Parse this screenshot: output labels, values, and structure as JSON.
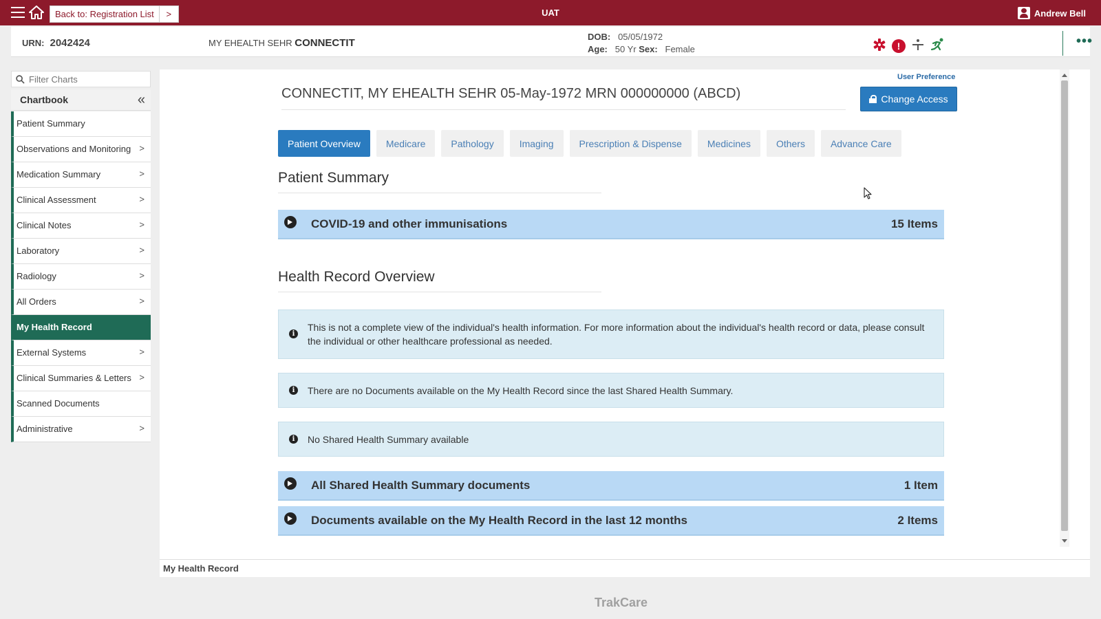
{
  "topbar": {
    "back_label": "Back to: Registration List",
    "env": "UAT",
    "user_name": "Andrew Bell"
  },
  "banner": {
    "urn_label": "URN:",
    "urn_value": "2042424",
    "name_prefix": "MY EHEALTH SEHR",
    "name_surname": "CONNECTIT",
    "dob_label": "DOB:",
    "dob_value": "05/05/1972",
    "age_label": "Age:",
    "age_value": "50 Yr",
    "sex_label": "Sex:",
    "sex_value": "Female"
  },
  "sidebar": {
    "filter_placeholder": "Filter Charts",
    "chartbook_label": "Chartbook",
    "items": [
      {
        "label": "Patient Summary"
      },
      {
        "label": "Observations and Monitoring"
      },
      {
        "label": "Medication Summary"
      },
      {
        "label": "Clinical Assessment"
      },
      {
        "label": "Clinical Notes"
      },
      {
        "label": "Laboratory"
      },
      {
        "label": "Radiology"
      },
      {
        "label": "All Orders"
      },
      {
        "label": "My Health Record"
      },
      {
        "label": "External Systems"
      },
      {
        "label": "Clinical Summaries & Letters"
      },
      {
        "label": "Scanned Documents"
      },
      {
        "label": "Administrative"
      }
    ]
  },
  "main": {
    "user_preference": "User Preference",
    "title": "CONNECTIT, MY EHEALTH SEHR 05-May-1972 MRN 000000000 (ABCD)",
    "change_access": "Change Access",
    "tabs": [
      {
        "label": "Patient Overview"
      },
      {
        "label": "Medicare"
      },
      {
        "label": "Pathology"
      },
      {
        "label": "Imaging"
      },
      {
        "label": "Prescription & Dispense"
      },
      {
        "label": "Medicines"
      },
      {
        "label": "Others"
      },
      {
        "label": "Advance Care"
      }
    ],
    "patient_summary_heading": "Patient Summary",
    "immunisations": {
      "title": "COVID-19 and other immunisations",
      "count": "15 Items"
    },
    "health_record_heading": "Health Record Overview",
    "info1": "This is not a complete view of the individual's health information. For more information about the individual's health record or data, please consult the individual or other healthcare professional as needed.",
    "info2": "There are no Documents available on the My Health Record since the last Shared Health Summary.",
    "info3": "No Shared Health Summary available",
    "shared_summary": {
      "title": "All Shared Health Summary documents",
      "count": "1 Item"
    },
    "documents_12m": {
      "title": "Documents available on the My Health Record in the last 12 months",
      "count": "2 Items"
    }
  },
  "footer": {
    "page_label": "My Health Record",
    "brand": "TrakCare"
  },
  "colors": {
    "topbar": "#8d1a2b",
    "nav_accent": "#1f6b56",
    "primary_button": "#2a7bbf",
    "accordion": "#b9d9f5",
    "info_box": "#dcedf5"
  }
}
